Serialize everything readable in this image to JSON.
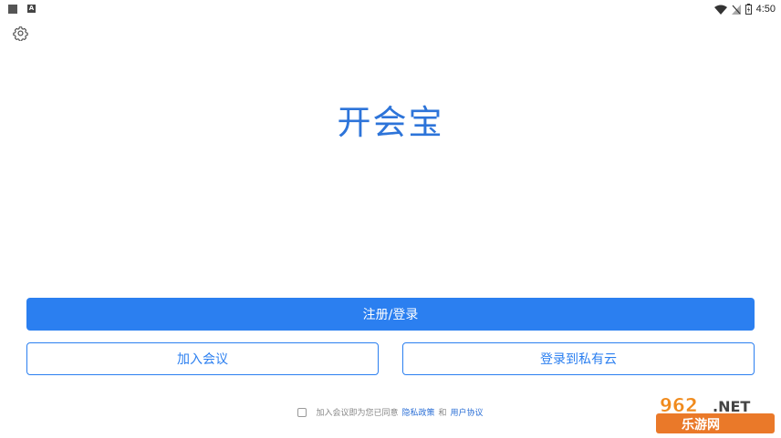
{
  "status_bar": {
    "time": "4:50",
    "notif_icon_letter": "A",
    "icons": [
      "notification-square-icon",
      "notification-a-icon",
      "wifi-icon",
      "no-signal-icon",
      "battery-icon"
    ]
  },
  "app": {
    "title": "开会宝",
    "accent_color": "#2b7ff0"
  },
  "actions": {
    "register_login": "注册/登录",
    "join_meeting": "加入会议",
    "login_private_cloud": "登录到私有云"
  },
  "agreement": {
    "prefix": "加入会议即为您已同意",
    "privacy_policy": "隐私政策",
    "and": "和",
    "user_agreement": "用户协议",
    "checked": false
  },
  "watermark": {
    "brand": "962.NET",
    "subtitle": "乐游网"
  }
}
